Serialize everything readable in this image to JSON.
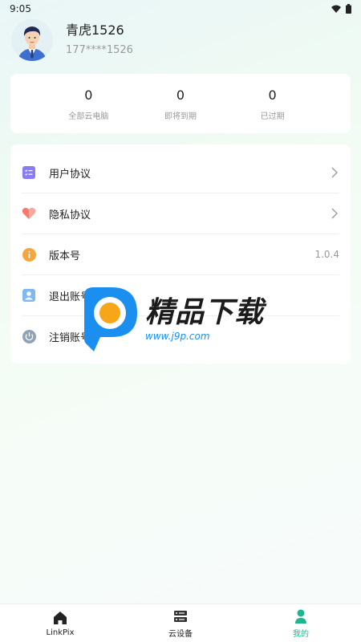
{
  "status_bar": {
    "time": "9:05"
  },
  "profile": {
    "name": "青虎1526",
    "phone": "177****1526"
  },
  "stats": [
    {
      "value": "0",
      "label": "全部云电脑"
    },
    {
      "value": "0",
      "label": "即将到期"
    },
    {
      "value": "0",
      "label": "已过期"
    }
  ],
  "menu": [
    {
      "label": "用户协议",
      "icon": "list-check-icon"
    },
    {
      "label": "隐私协议",
      "icon": "heart-icon"
    },
    {
      "label": "版本号",
      "value": "1.0.4",
      "icon": "info-icon"
    },
    {
      "label": "退出账号",
      "icon": "user-icon"
    },
    {
      "label": "注销账号",
      "icon": "power-icon"
    }
  ],
  "watermark": {
    "title": "精品下载",
    "url": "www.j9p.com"
  },
  "bottom_nav": [
    {
      "label": "LinkPix",
      "icon": "home-icon"
    },
    {
      "label": "云设备",
      "icon": "server-icon"
    },
    {
      "label": "我的",
      "icon": "person-icon"
    }
  ],
  "colors": {
    "accent": "#1fb58f",
    "watermark_blue": "#1a8ff0"
  }
}
